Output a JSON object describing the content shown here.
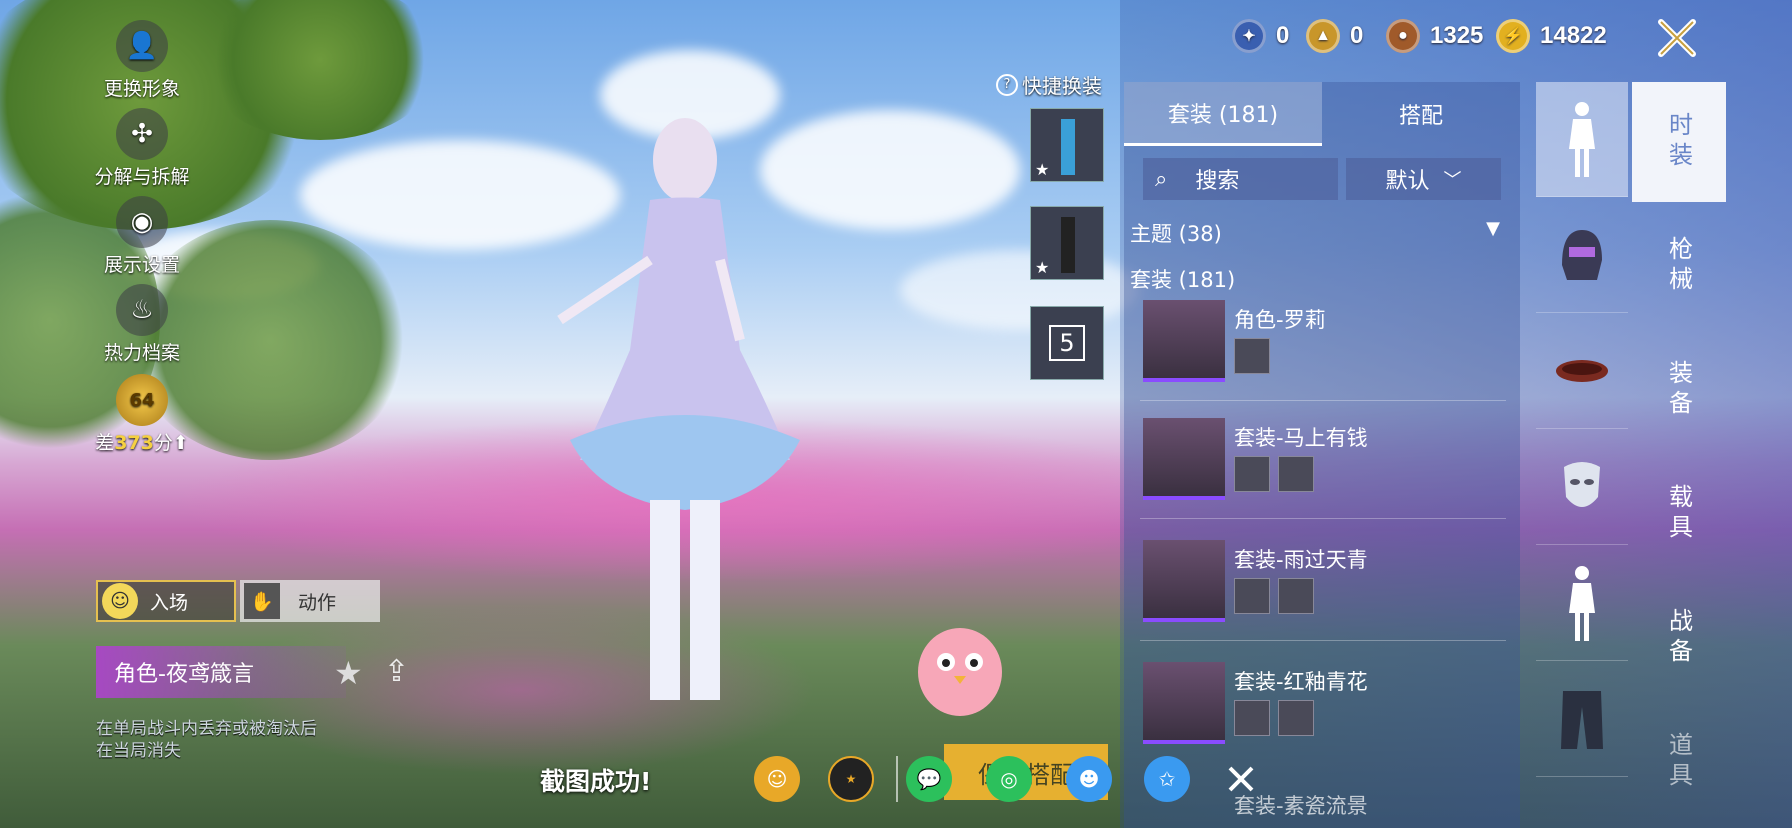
{
  "currencies": [
    {
      "icon": "blue-medal-icon",
      "value": "0",
      "color": "#3a5fb0"
    },
    {
      "icon": "gold-medal-icon",
      "value": "0",
      "color": "#c8962a"
    },
    {
      "icon": "bronze-coin-icon",
      "value": "1325",
      "color": "#a05a2a"
    },
    {
      "icon": "lightning-coin-icon",
      "value": "14822",
      "color": "#e2b020"
    }
  ],
  "left_menu": [
    {
      "label": "更换形象",
      "icon": "person-icon"
    },
    {
      "label": "分解与拆解",
      "icon": "puzzle-icon"
    },
    {
      "label": "展示设置",
      "icon": "eye-icon"
    },
    {
      "label": "热力档案",
      "icon": "flame-icon"
    }
  ],
  "level_badge": {
    "level": "64",
    "prefix": "差",
    "points": "373",
    "suffix": "分"
  },
  "entrance_button": "入场",
  "action_button": "动作",
  "character_name": "角色-夜鸢箴言",
  "character_note_line1": "在单局战斗内丢弃或被淘汰后",
  "character_note_line2": "在当局消失",
  "quick_change": {
    "title": "快捷换装",
    "slot3_label": "5"
  },
  "tabs": {
    "suits": "套装 (181)",
    "match": "搭配"
  },
  "search": {
    "label": "搜索",
    "sort": "默认"
  },
  "sections": {
    "theme": "主题 (38)",
    "suits": "套装 (181)"
  },
  "items": [
    {
      "name": "角色-罗莉"
    },
    {
      "name": "套装-马上有钱"
    },
    {
      "name": "套装-雨过天青"
    },
    {
      "name": "套装-红釉青花"
    },
    {
      "name": "套装-素瓷流景"
    }
  ],
  "side_tabs": [
    "时装",
    "枪械",
    "装备",
    "载具",
    "战备",
    "道具"
  ],
  "share": {
    "title": "截图成功!",
    "save_label": "保存搭配"
  }
}
